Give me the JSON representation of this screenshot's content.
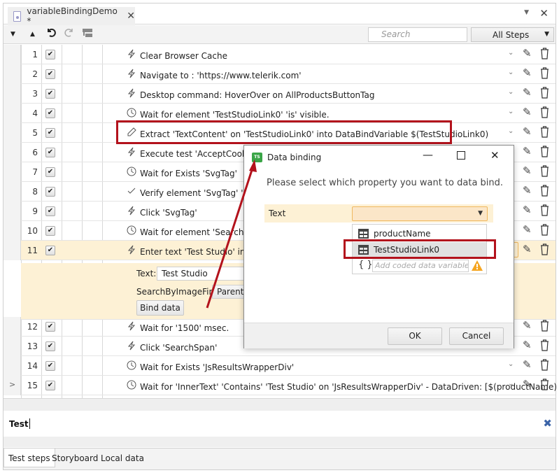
{
  "document_tab": {
    "title": "variableBindingDemo *",
    "icon": "file-icon",
    "close_icon": "close-icon"
  },
  "window_controls": {
    "menu_dropdown_icon": "chevron-down-icon",
    "close_icon": "close-icon"
  },
  "toolbar": {
    "move_down_icon": "triangle-down-icon",
    "move_up_icon": "triangle-up-icon",
    "undo_icon": "undo-icon",
    "redo_icon": "redo-icon",
    "group_icon": "group-steps-icon",
    "search_placeholder": "Search",
    "filter_value": "All Steps"
  },
  "steps": [
    {
      "num": "1",
      "checked": true,
      "icon": "lightning-icon",
      "text": "Clear Browser Cache"
    },
    {
      "num": "2",
      "checked": true,
      "icon": "lightning-icon",
      "text": "Navigate to : 'https://www.telerik.com'"
    },
    {
      "num": "3",
      "checked": true,
      "icon": "lightning-icon",
      "text": "Desktop command: HoverOver on AllProductsButtonTag"
    },
    {
      "num": "4",
      "checked": true,
      "icon": "clock-icon",
      "text": "Wait for element 'TestStudioLink0' 'is' visible."
    },
    {
      "num": "5",
      "checked": true,
      "icon": "pipette-icon",
      "text": "Extract 'TextContent' on 'TestStudioLink0' into DataBindVariable $(TestStudioLink0)"
    },
    {
      "num": "6",
      "checked": true,
      "icon": "lightning-icon",
      "text": "Execute test 'AcceptCookies('"
    },
    {
      "num": "7",
      "checked": true,
      "icon": "clock-icon",
      "text": "Wait for Exists 'SvgTag'"
    },
    {
      "num": "8",
      "checked": true,
      "icon": "check-icon",
      "text": "Verify element 'SvgTag' 'is' vis"
    },
    {
      "num": "9",
      "checked": true,
      "icon": "lightning-icon",
      "text": "Click 'SvgTag'"
    },
    {
      "num": "10",
      "checked": true,
      "icon": "clock-icon",
      "text": "Wait for element 'SearchInpu"
    },
    {
      "num": "11",
      "checked": true,
      "icon": "lightning-icon",
      "text": "Enter text 'Test Studio' in 'Sea"
    },
    {
      "num": "12",
      "checked": true,
      "icon": "lightning-icon",
      "text": "Wait for '1500' msec."
    },
    {
      "num": "13",
      "checked": true,
      "icon": "lightning-icon",
      "text": "Click 'SearchSpan'"
    },
    {
      "num": "14",
      "checked": true,
      "icon": "clock-icon",
      "text": "Wait for Exists 'JsResultsWrapperDiv'"
    },
    {
      "num": "15",
      "checked": true,
      "icon": "clock-icon",
      "text": "Wait for 'InnerText' 'Contains' 'Test Studio' on 'JsResultsWrapperDiv' - DataDriven: [$(productName)",
      "gutter": ">"
    }
  ],
  "expanded_step": {
    "text_label": "Text:",
    "text_value": "Test Studio",
    "search_label": "SearchByImageFirst:",
    "search_value": "ParentS",
    "bind_button": "Bind data"
  },
  "dialog": {
    "title": "Data binding",
    "logo_text": "TS",
    "minimize_icon": "minimize-icon",
    "maximize_icon": "maximize-icon",
    "close_icon": "close-icon",
    "prompt": "Please select which property you want to data bind.",
    "property_label": "Text",
    "property_value": "",
    "options": [
      {
        "label": "productName",
        "icon": "table-icon"
      },
      {
        "label": "TestStudioLink0",
        "icon": "table-icon",
        "highlighted": true
      }
    ],
    "coded_variable_placeholder": "Add coded data variable",
    "ok_label": "OK",
    "cancel_label": "Cancel"
  },
  "command_input": {
    "value": "Test",
    "clear_icon": "clear-icon"
  },
  "bottom_tabs": [
    {
      "label": "Test steps",
      "active": true
    },
    {
      "label": "Storyboard",
      "active": false
    },
    {
      "label": "Local data",
      "active": false
    }
  ],
  "colors": {
    "selected_row": "#fdf1d5",
    "highlight_border": "#b3121c",
    "accent_orange": "#f0b860",
    "ts_logo_green": "#3aa547",
    "clear_icon_blue": "#3b64a8"
  }
}
